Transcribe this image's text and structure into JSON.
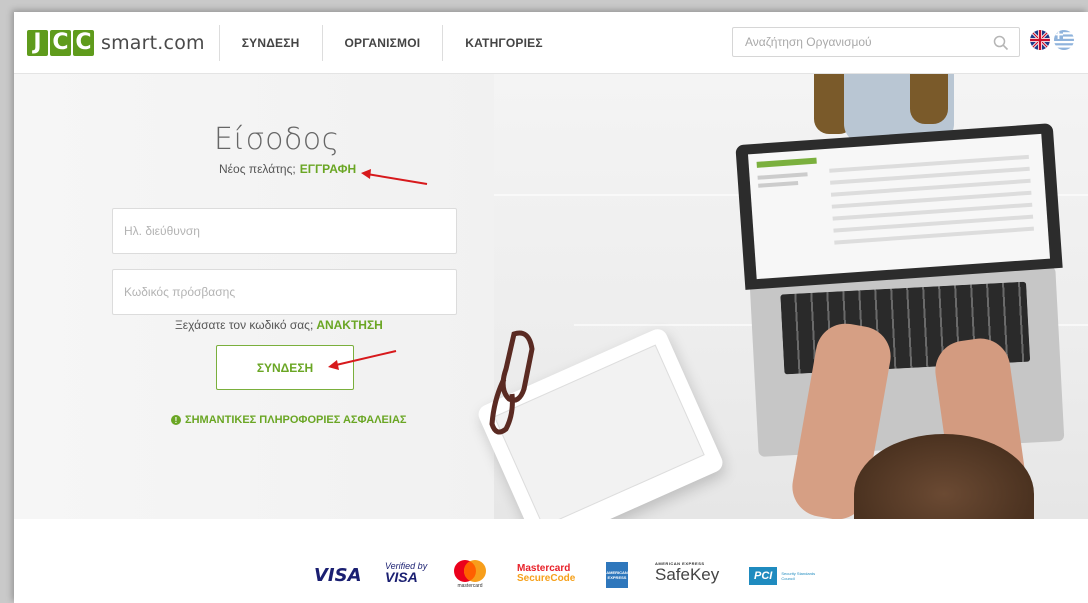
{
  "header": {
    "logo_letters": [
      "J",
      "C",
      "C"
    ],
    "logo_text": "smart.com",
    "nav": [
      {
        "label": "ΣΥΝΔΕΣΗ"
      },
      {
        "label": "ΟΡΓΑΝΙΣΜΟΙ"
      },
      {
        "label": "ΚΑΤΗΓΟΡΙΕΣ"
      }
    ],
    "search_placeholder": "Αναζήτηση Οργανισμού",
    "languages": [
      "en-flag-icon",
      "el-flag-icon"
    ]
  },
  "login": {
    "title": "Είσοδος",
    "new_client_text": "Νέος πελάτης;",
    "register_link": "ΕΓΓΡΑΦΗ",
    "email_placeholder": "Ηλ. διεύθυνση",
    "password_placeholder": "Κωδικός πρόσβασης",
    "forgot_text": "Ξεχάσατε τον κωδικό σας;",
    "recover_link": "ΑΝΑΚΤΗΣΗ",
    "login_button": "ΣΥΝΔΕΣΗ",
    "security_info": "ΣΗΜΑΝΤΙΚΕΣ ΠΛΗΡΟΦΟΡΙΕΣ ΑΣΦΑΛΕΙΑΣ"
  },
  "colors": {
    "brand_green": "#6aa624",
    "logo_green": "#5f9b1c",
    "annotation_red": "#d7191c"
  },
  "footer": {
    "payment_logos": {
      "visa": "VISA",
      "verified_top": "Verified by",
      "verified_bottom": "VISA",
      "mastercard_small": "mastercard",
      "mc_secure_top": "Mastercard",
      "mc_secure_bottom": "SecureCode",
      "amex": "AMERICAN EXPRESS",
      "safekey_top": "AMERICAN EXPRESS",
      "safekey_main": "SafeKey",
      "pci": "PCI",
      "pci_small": "Security Standards Council"
    }
  }
}
